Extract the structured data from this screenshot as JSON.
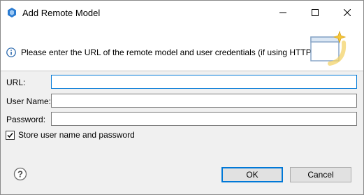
{
  "window": {
    "title": "Add Remote Model"
  },
  "banner": {
    "message": "Please enter the URL of the remote model and user credentials (if using HTTP)"
  },
  "form": {
    "url": {
      "label": "URL:",
      "value": ""
    },
    "username": {
      "label": "User Name:",
      "value": ""
    },
    "password": {
      "label": "Password:",
      "value": ""
    },
    "store_credentials": {
      "label": "Store user name and password",
      "checked": true
    }
  },
  "buttons": {
    "ok": "OK",
    "cancel": "Cancel"
  },
  "icons": {
    "app": "eclipse-hexagon-icon",
    "info": "info-icon",
    "help": "help-icon",
    "wizard": "wizard-banner-icon"
  },
  "colors": {
    "accent": "#0078d7",
    "dialog_bg": "#f0f0f0",
    "banner_bg": "#ffffff"
  }
}
